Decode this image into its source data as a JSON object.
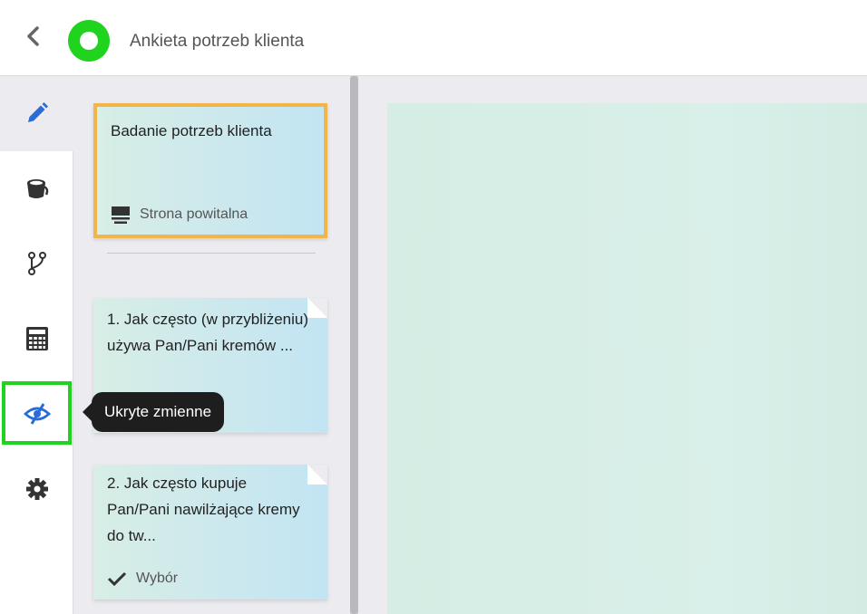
{
  "header": {
    "title": "Ankieta potrzeb klienta"
  },
  "rail": {
    "items": [
      {
        "icon": "pencil-icon"
      },
      {
        "icon": "bucket-icon"
      },
      {
        "icon": "branch-icon"
      },
      {
        "icon": "calculator-icon"
      },
      {
        "icon": "eye-slash-icon"
      },
      {
        "icon": "gear-icon"
      }
    ],
    "tooltip": "Ukryte zmienne"
  },
  "cards": [
    {
      "title": "Badanie potrzeb klienta",
      "footer": "Strona powitalna",
      "icon": "welcome-page-icon"
    },
    {
      "title": "1. Jak często (w przybliżeniu) używa Pan/Pani kremów ..."
    },
    {
      "title": "2. Jak często kupuje Pan/Pani nawilżające kremy do tw...",
      "footer": "Wybór",
      "icon": "check-icon"
    }
  ],
  "colors": {
    "brand": "#1fd31f",
    "selected_border": "#f2b549",
    "active_icon": "#2b6bd8"
  }
}
